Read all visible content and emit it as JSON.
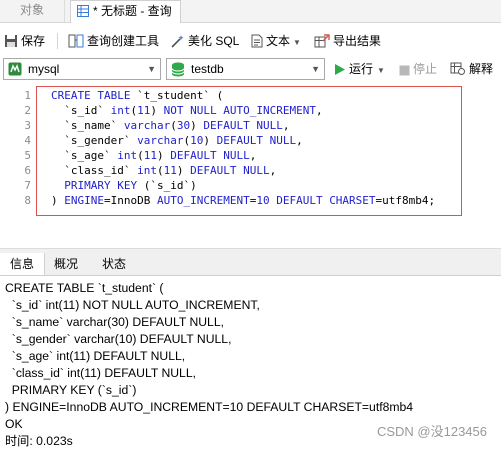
{
  "tabs": {
    "objects": "对象",
    "query": "* 无标题 - 查询"
  },
  "toolbar": {
    "save": "保存",
    "query_builder": "查询创建工具",
    "beautify_sql": "美化 SQL",
    "text": "文本",
    "export": "导出结果"
  },
  "connection": {
    "server": "mysql",
    "database": "testdb",
    "run": "运行",
    "stop": "停止",
    "explain": "解释"
  },
  "editor": {
    "line_numbers": [
      "1",
      "2",
      "3",
      "4",
      "5",
      "6",
      "7",
      "8"
    ],
    "lines": [
      "CREATE TABLE `t_student` (",
      "  `s_id` int(11) NOT NULL AUTO_INCREMENT,",
      "  `s_name` varchar(30) DEFAULT NULL,",
      "  `s_gender` varchar(10) DEFAULT NULL,",
      "  `s_age` int(11) DEFAULT NULL,",
      "  `class_id` int(11) DEFAULT NULL,",
      "  PRIMARY KEY (`s_id`)",
      ") ENGINE=InnoDB AUTO_INCREMENT=10 DEFAULT CHARSET=utf8mb4;"
    ]
  },
  "result_tabs": {
    "info": "信息",
    "profile": "概况",
    "status": "状态"
  },
  "output": {
    "lines": [
      "CREATE TABLE `t_student` (",
      "  `s_id` int(11) NOT NULL AUTO_INCREMENT,",
      "  `s_name` varchar(30) DEFAULT NULL,",
      "  `s_gender` varchar(10) DEFAULT NULL,",
      "  `s_age` int(11) DEFAULT NULL,",
      "  `class_id` int(11) DEFAULT NULL,",
      "  PRIMARY KEY (`s_id`)",
      ") ENGINE=InnoDB AUTO_INCREMENT=10 DEFAULT CHARSET=utf8mb4",
      "OK",
      "时间: 0.023s"
    ]
  },
  "watermark": "CSDN @没123456"
}
